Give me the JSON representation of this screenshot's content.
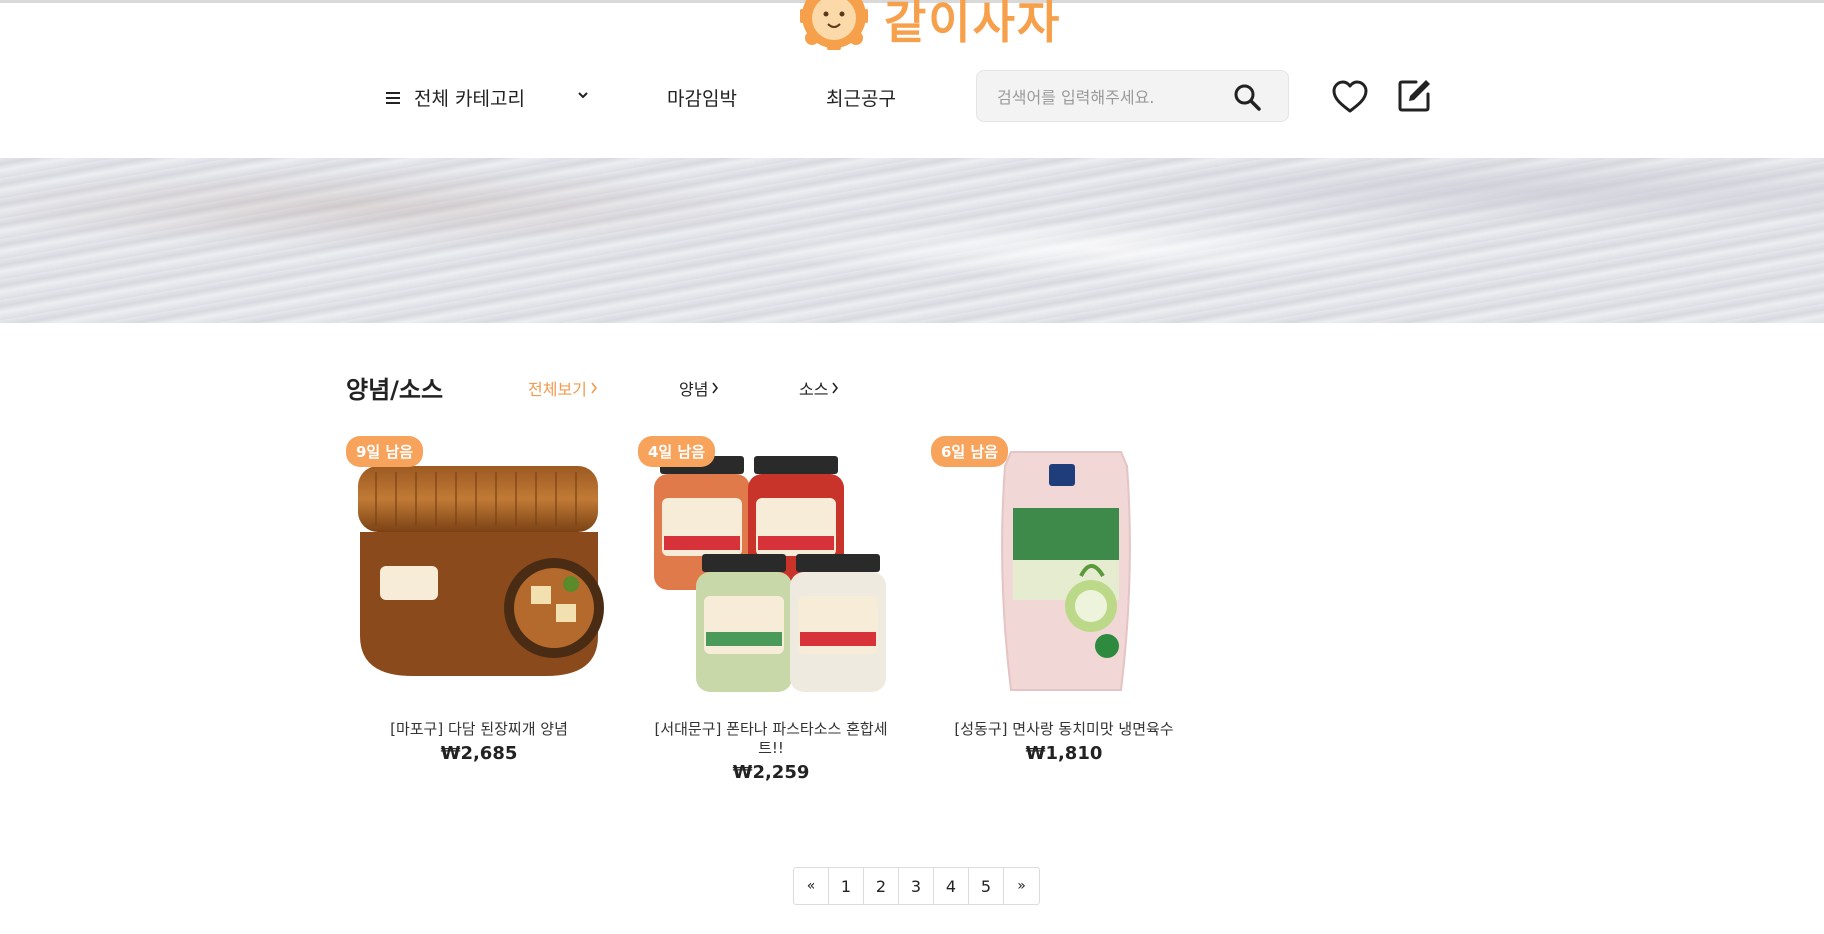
{
  "brand": {
    "name": "같이사자",
    "color": "#f7a04b"
  },
  "nav": {
    "category_label": "전체 카테고리",
    "deadline_label": "마감임박",
    "recent_label": "최근공구"
  },
  "search": {
    "placeholder": "검색어를 입력해주세요.",
    "value": ""
  },
  "section": {
    "title": "양념/소스",
    "subcategories": [
      {
        "label": "전체보기",
        "active": true
      },
      {
        "label": "양념",
        "active": false
      },
      {
        "label": "소스",
        "active": false
      }
    ]
  },
  "products": [
    {
      "badge": "9일 남음",
      "name": "[마포구] 다담 된장찌개 양념",
      "price": "₩2,685",
      "image_icon": "doenjang-jar-image"
    },
    {
      "badge": "4일 남음",
      "name": "[서대문구] 폰타나 파스타소스 혼합세트!!",
      "price": "₩2,259",
      "image_icon": "pasta-sauce-jars-image"
    },
    {
      "badge": "6일 남음",
      "name": "[성동구] 면사랑 동치미맛 냉면육수",
      "price": "₩1,810",
      "image_icon": "naengmyeon-broth-pouch-image"
    }
  ],
  "pagination": {
    "first": "«",
    "pages": [
      "1",
      "2",
      "3",
      "4",
      "5"
    ],
    "last": "»"
  },
  "colors": {
    "accent": "#f39a4e",
    "badge": "#f7a35c"
  }
}
